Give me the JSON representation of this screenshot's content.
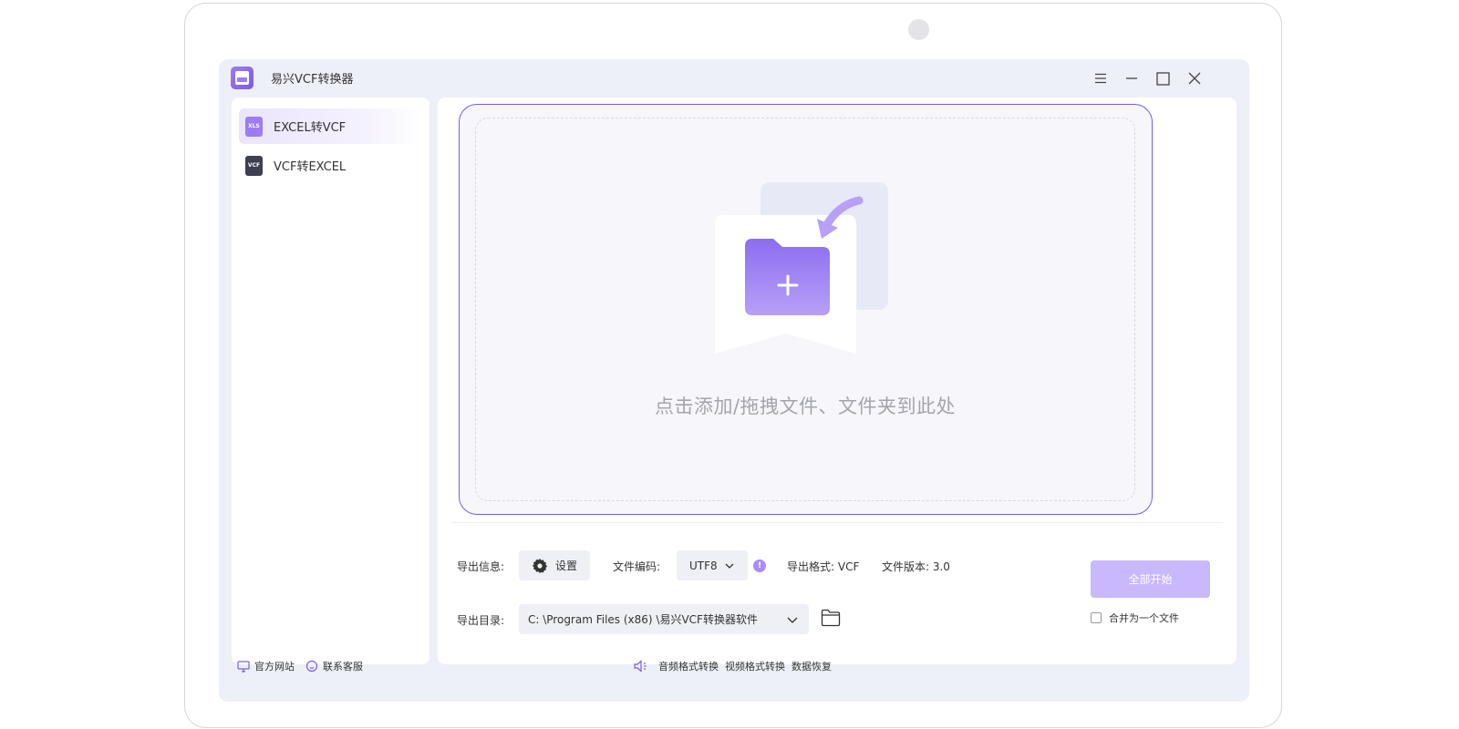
{
  "app": {
    "title": "易兴VCF转换器"
  },
  "sidebar": {
    "items": [
      {
        "label": "EXCEL转VCF",
        "icon": "xls-file-icon",
        "icon_text": "XLS",
        "active": true
      },
      {
        "label": "VCF转EXCEL",
        "icon": "vcf-file-icon",
        "icon_text": "VCF",
        "active": false
      }
    ]
  },
  "dropzone": {
    "text": "点击添加/拖拽文件、文件夹到此处"
  },
  "options": {
    "export_info_label": "导出信息:",
    "settings_label": "设置",
    "encoding_label": "文件编码:",
    "encoding_value": "UTF8",
    "format_label": "导出格式: VCF",
    "version_label": "文件版本: 3.0",
    "dir_label": "导出目录:",
    "dir_value": "C: \\Program  Files (x86) \\易兴VCF转换器软件"
  },
  "actions": {
    "start_label": "全部开始",
    "merge_label": "合并为一个文件"
  },
  "footer": {
    "website": "官方网站",
    "support": "联系客服",
    "audio": "音频格式转换",
    "video": "视频格式转换",
    "recovery": "数据恢复"
  },
  "colors": {
    "accent": "#7b5be6",
    "accent_light": "#9a7cf4",
    "start_disabled": "#c9b8fb"
  }
}
